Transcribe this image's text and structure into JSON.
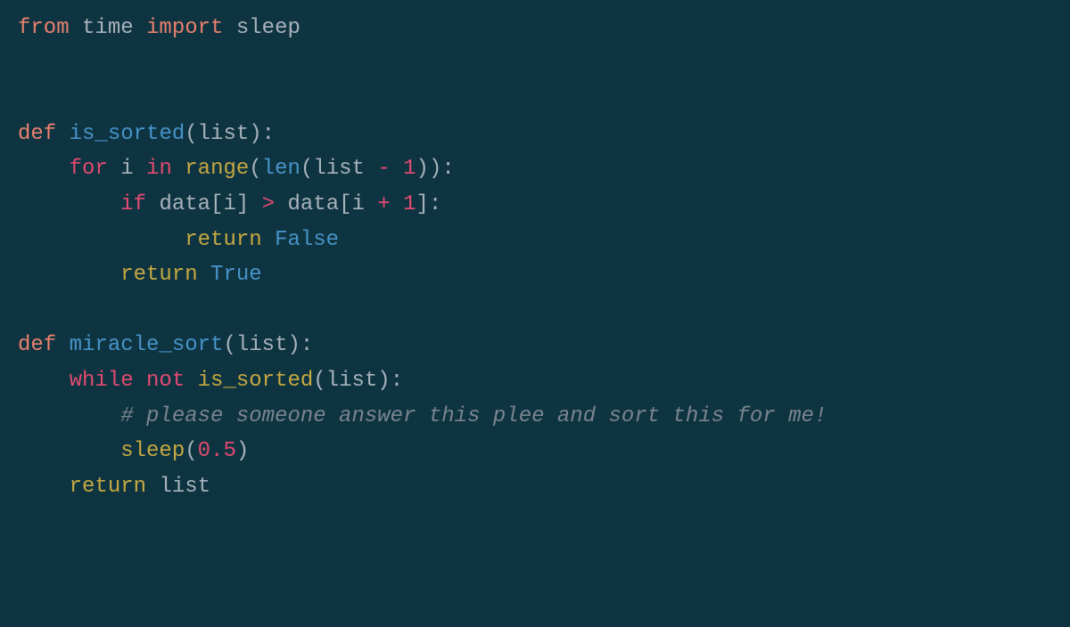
{
  "code": {
    "line1": {
      "kw_from": "from",
      "mod": "time",
      "kw_import": "import",
      "ident": "sleep"
    },
    "line3": {
      "kw_def": "def",
      "fn": "is_sorted",
      "lp": "(",
      "param": "list",
      "rp": "):"
    },
    "line4": {
      "kw_for": "for",
      "var": "i",
      "kw_in": "in",
      "range": "range",
      "lp": "(",
      "len": "len",
      "lp2": "(",
      "list": "list",
      "minus": "-",
      "one": "1",
      "rp": "))",
      "colon": ":"
    },
    "line5": {
      "kw_if": "if",
      "data1": "data[i]",
      "gt": ">",
      "data2": "data[i",
      "plus": "+",
      "one": "1",
      "rb": "]:"
    },
    "line6": {
      "kw_return": "return",
      "val": "False"
    },
    "line7": {
      "kw_return": "return",
      "val": "True"
    },
    "line9": {
      "kw_def": "def",
      "fn": "miracle_sort",
      "lp": "(",
      "param": "list",
      "rp": "):"
    },
    "line10": {
      "kw_while": "while",
      "kw_not": "not",
      "fn": "is_sorted",
      "lp": "(",
      "arg": "list",
      "rp": "):"
    },
    "line11": {
      "comment": "# please someone answer this plee and sort this for me!"
    },
    "line12": {
      "fn": "sleep",
      "lp": "(",
      "num": "0.5",
      "rp": ")"
    },
    "line13": {
      "kw_return": "return",
      "val": "list"
    }
  }
}
